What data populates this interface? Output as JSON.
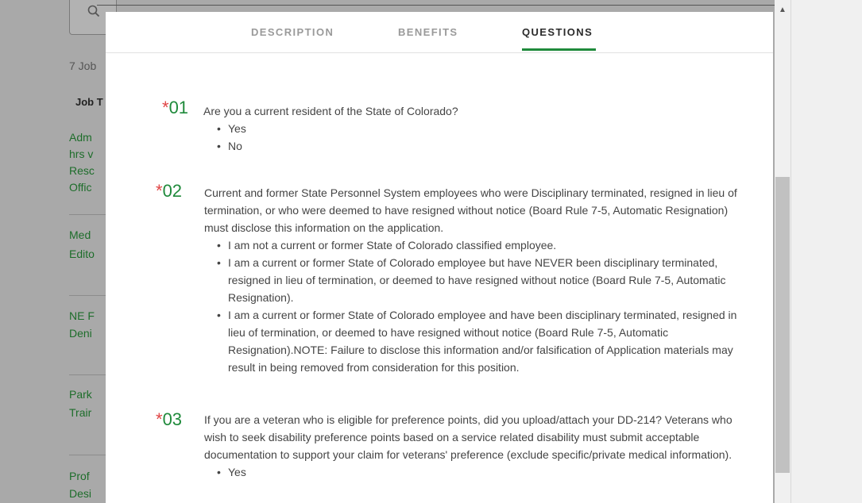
{
  "background": {
    "job_count": "7 Job",
    "table_header": "Job T",
    "links": [
      "Adm",
      "hrs v",
      "Resc",
      "Offic",
      "Med",
      "Edito",
      "NE F",
      "Deni",
      "Park",
      "Trair",
      "Prof",
      "Desi"
    ]
  },
  "tabs": [
    {
      "label": "DESCRIPTION",
      "active": false
    },
    {
      "label": "BENEFITS",
      "active": false
    },
    {
      "label": "QUESTIONS",
      "active": true
    }
  ],
  "questions": [
    {
      "required_marker": "*",
      "number": "01",
      "text": "Are you a current resident of the State of Colorado?",
      "options": [
        "Yes",
        "No"
      ]
    },
    {
      "required_marker": "*",
      "number": "02",
      "text": "Current and former State Personnel System employees who were Disciplinary terminated, resigned in lieu of termination, or who were deemed to have resigned without notice (Board Rule 7-5, Automatic Resignation) must disclose this information on the application.",
      "options": [
        "I am not a current or former State of Colorado classified employee.",
        "I am a current or former State of Colorado employee but have NEVER been disciplinary terminated, resigned in lieu of termination, or deemed to have resigned without notice (Board Rule 7-5, Automatic Resignation).",
        "I am a current or former State of Colorado employee and have been disciplinary terminated, resigned in lieu of termination, or deemed to have resigned without notice (Board Rule 7-5, Automatic Resignation).NOTE: Failure to disclose this information and/or falsification of Application materials may result in being removed from consideration for this position."
      ]
    },
    {
      "required_marker": "*",
      "number": "03",
      "text": "If you are a veteran who is eligible for preference points, did you upload/attach your DD-214? Veterans who wish to seek disability preference points based on a service related disability must submit acceptable documentation to support your claim for veterans' preference (exclude specific/private medical information).",
      "options": [
        "Yes"
      ]
    }
  ],
  "icons": {
    "search": "search-icon",
    "scroll_up": "scroll-up-arrow-icon"
  },
  "colors": {
    "accent_green": "#1f8a3b",
    "required_red": "#e04545"
  }
}
